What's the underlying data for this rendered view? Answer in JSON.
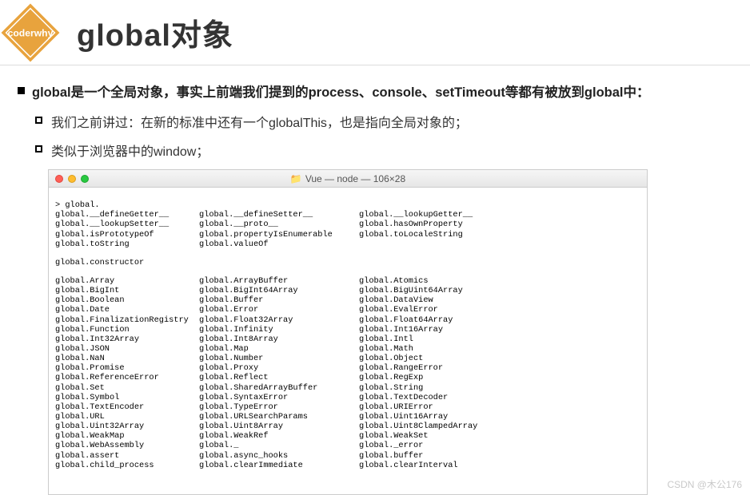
{
  "header": {
    "logo_text": "coderwhy",
    "title": "global对象"
  },
  "bullets": {
    "main": "global是一个全局对象，事实上前端我们提到的process、console、setTimeout等都有被放到global中：",
    "sub1": "我们之前讲过：在新的标准中还有一个globalThis，也是指向全局对象的；",
    "sub2": "类似于浏览器中的window；"
  },
  "terminal": {
    "title": "Vue — node — 106×28",
    "prompt": "> global.",
    "block1": {
      "c1": [
        "global.__defineGetter__",
        "global.__lookupSetter__",
        "global.isPrototypeOf",
        "global.toString"
      ],
      "c2": [
        "global.__defineSetter__",
        "global.__proto__",
        "global.propertyIsEnumerable",
        "global.valueOf"
      ],
      "c3": [
        "global.__lookupGetter__",
        "global.hasOwnProperty",
        "global.toLocaleString",
        ""
      ]
    },
    "line2": "global.constructor",
    "block2": {
      "c1": [
        "global.Array",
        "global.BigInt",
        "global.Boolean",
        "global.Date",
        "global.FinalizationRegistry",
        "global.Function",
        "global.Int32Array",
        "global.JSON",
        "global.NaN",
        "global.Promise",
        "global.ReferenceError",
        "global.Set",
        "global.Symbol",
        "global.TextEncoder",
        "global.URL",
        "global.Uint32Array",
        "global.WeakMap",
        "global.WebAssembly",
        "global.assert",
        "global.child_process"
      ],
      "c2": [
        "global.ArrayBuffer",
        "global.BigInt64Array",
        "global.Buffer",
        "global.Error",
        "global.Float32Array",
        "global.Infinity",
        "global.Int8Array",
        "global.Map",
        "global.Number",
        "global.Proxy",
        "global.Reflect",
        "global.SharedArrayBuffer",
        "global.SyntaxError",
        "global.TypeError",
        "global.URLSearchParams",
        "global.Uint8Array",
        "global.WeakRef",
        "global._",
        "global.async_hooks",
        "global.clearImmediate"
      ],
      "c3": [
        "global.Atomics",
        "global.BigUint64Array",
        "global.DataView",
        "global.EvalError",
        "global.Float64Array",
        "global.Int16Array",
        "global.Intl",
        "global.Math",
        "global.Object",
        "global.RangeError",
        "global.RegExp",
        "global.String",
        "global.TextDecoder",
        "global.URIError",
        "global.Uint16Array",
        "global.Uint8ClampedArray",
        "global.WeakSet",
        "global._error",
        "global.buffer",
        "global.clearInterval"
      ]
    }
  },
  "watermark": "CSDN @木公176"
}
